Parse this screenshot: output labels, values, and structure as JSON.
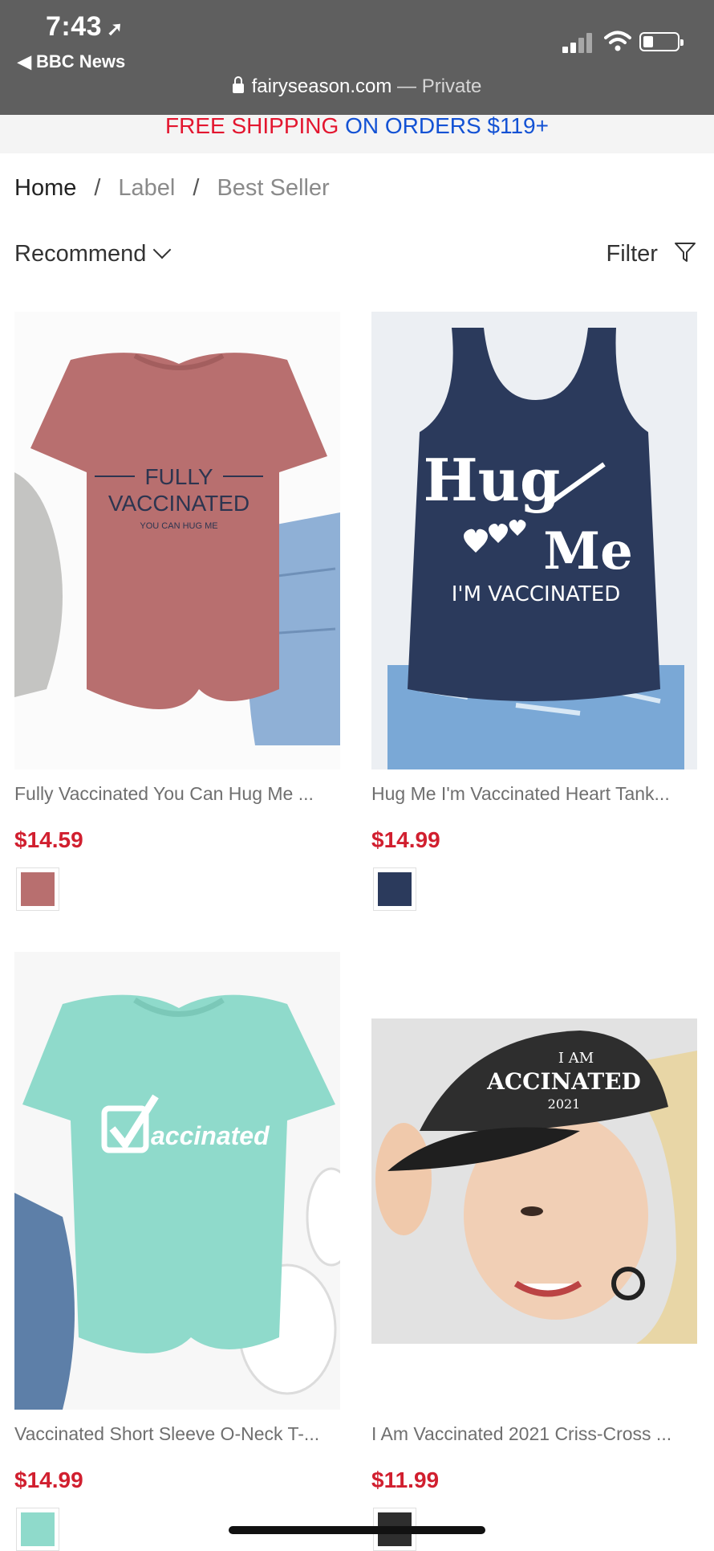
{
  "status_bar": {
    "time": "7:43",
    "back_app": "BBC News"
  },
  "browser": {
    "domain": "fairyseason.com",
    "private_label": "Private"
  },
  "banner": {
    "part1": "FREE SHIPPING",
    "part2": "ON ORDERS $119+"
  },
  "breadcrumb": [
    "Home",
    "Label",
    "Best Seller"
  ],
  "sort": {
    "label": "Recommend"
  },
  "filter": {
    "label": "Filter"
  },
  "products": [
    {
      "title": "Fully Vaccinated You Can Hug Me ...",
      "price": "$14.59",
      "swatch": "#b86f6f",
      "art": {
        "line1": "FULLY",
        "line2": "VACCINATED",
        "line3": "YOU CAN HUG ME"
      }
    },
    {
      "title": "Hug Me I'm Vaccinated Heart Tank...",
      "price": "$14.99",
      "swatch": "#2b3a5c",
      "art": {
        "line1": "Hug",
        "line2": "Me",
        "line3": "I'M VACCINATED"
      }
    },
    {
      "title": "Vaccinated Short Sleeve O-Neck T-...",
      "price": "$14.99",
      "swatch": "#8fdacb",
      "art": {
        "line1": "accinated"
      }
    },
    {
      "title": "I Am Vaccinated 2021 Criss-Cross ...",
      "price": "$11.99",
      "swatch": "#2e2e2e",
      "art": {
        "line1": "I AM",
        "line2": "ACCINATED",
        "line3": "2021"
      }
    }
  ],
  "colors": {
    "banner_red": "#e3162f",
    "banner_blue": "#1352d4",
    "price": "#d11f2f"
  }
}
